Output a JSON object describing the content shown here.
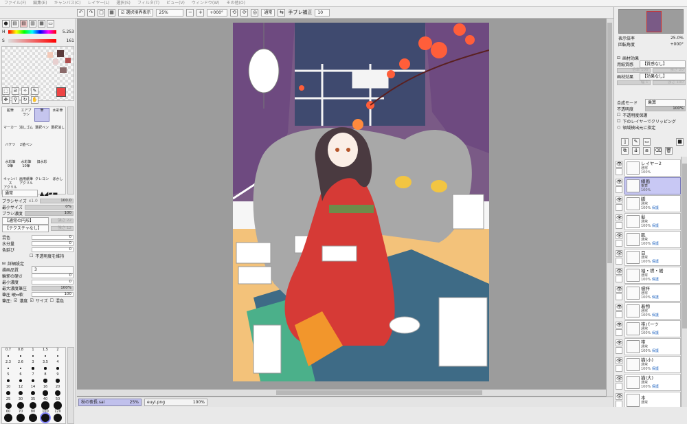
{
  "menu": [
    "ファイル(F)",
    "編集(E)",
    "キャンバス(C)",
    "レイヤー(L)",
    "選択(S)",
    "フィルタ(T)",
    "ビュー(V)",
    "ウィンドウ(W)",
    "その他(O)"
  ],
  "toolbar": {
    "selection_outline_label": "選択境界表示",
    "zoom_value": "25%",
    "rotate_value": "+000°",
    "mode_value": "通常",
    "stabilizer_label": "手ブレ補正",
    "stabilizer_value": "10"
  },
  "color_panel": {
    "h_label": "H",
    "h_value": "5.253",
    "s_label": "S",
    "s_value": "161",
    "v_label": "V",
    "v_value": "240",
    "primary_color": "#ee4444"
  },
  "tools": [
    {
      "label": "鉛筆"
    },
    {
      "label": "エアブラシ"
    },
    {
      "label": "筆"
    },
    {
      "label": "水彩筆"
    },
    {
      "label": "マーカー"
    },
    {
      "label": "消しゴム"
    },
    {
      "label": "選択ペン"
    },
    {
      "label": "選択消し"
    },
    {
      "label": "バケツ"
    },
    {
      "label": "2値ペン"
    },
    {
      "label": ""
    },
    {
      "label": ""
    },
    {
      "label": "水彩筆\n9筆"
    },
    {
      "label": "水彩筆\n10筆"
    },
    {
      "label": "旧水彩"
    },
    {
      "label": ""
    },
    {
      "label": "キャンバス\nアクリル"
    },
    {
      "label": "画用紙筆\nアクリル"
    },
    {
      "label": "クレヨン"
    },
    {
      "label": "ぼかし"
    }
  ],
  "brush": {
    "blend_mode": "通常",
    "size_label": "ブラシサイズ",
    "size_mult": "x1.0",
    "size_value": "100.0",
    "min_size_label": "最小サイズ",
    "min_size_value": "0%",
    "density_label": "ブラシ濃度",
    "density_value": "100",
    "shape_label": "【通常の円形】",
    "shape_value": "強さ 22",
    "texture_label": "【テクスチャなし】",
    "texture_value": "強さ 12",
    "mix_label": "混色",
    "mix_value": "0",
    "water_label": "水分量",
    "water_value": "0",
    "persist_label": "色延び",
    "persist_value": "0",
    "keep_opacity_label": "不透明度を維持",
    "advanced_label": "詳細設定",
    "quality_label": "描画品質",
    "quality_value": "3",
    "edge_label": "輪郭の硬さ",
    "edge_value": "0",
    "min_density_label": "最小濃度",
    "min_density_value": "0",
    "max_density_label": "最大濃度筆圧",
    "max_density_value": "100%",
    "pressure_label": "筆圧 硬⇔軟",
    "pressure_value": "100",
    "pressure_opts_label": "筆圧:",
    "pressure_density": "濃度",
    "pressure_size": "サイズ",
    "pressure_mix": "混色"
  },
  "brush_sizes": [
    "0.7",
    "0.8",
    "1",
    "1.5",
    "2",
    "2.3",
    "2.6",
    "3",
    "3.5",
    "4",
    "5",
    "6",
    "7",
    "8",
    "9",
    "10",
    "12",
    "14",
    "16",
    "20",
    "25",
    "30",
    "35",
    "40",
    "50",
    "60",
    "70",
    "80",
    "100",
    "120"
  ],
  "documents": [
    {
      "name": "秋の夜長.sai",
      "zoom": "25%",
      "active": true
    },
    {
      "name": "euyi.png",
      "zoom": "100%",
      "active": false
    }
  ],
  "navigator": {
    "zoom_label": "表示倍率",
    "zoom_value": "25.0%",
    "angle_label": "回転角度",
    "angle_value": "+000°"
  },
  "paper_effect": {
    "header": "画材効果",
    "texture_label": "用紙質感",
    "texture_value": "【質感なし】",
    "texture_scale": "倍率 100",
    "texture_strength": "強さ 20",
    "effect_label": "画材効果",
    "effect_value": "【効果なし】",
    "effect_width": "幅 1",
    "effect_strength": "強さ 100"
  },
  "layer_props": {
    "blend_label": "合成モード",
    "blend_value": "乗算",
    "opacity_label": "不透明度",
    "opacity_value": "100%",
    "protect_opacity": "不透明度保護",
    "clip": "下のレイヤーでクリッピング",
    "selection_source": "領域検出元に指定"
  },
  "layers": [
    {
      "name": "レイヤー2",
      "mode": "通常",
      "opacity": "100%",
      "protect": "",
      "selected": false
    },
    {
      "name": "線画",
      "mode": "乗算",
      "opacity": "100%",
      "protect": "",
      "selected": true
    },
    {
      "name": "脚",
      "mode": "通常",
      "opacity": "100%",
      "protect": "保護",
      "selected": false
    },
    {
      "name": "髪",
      "mode": "通常",
      "opacity": "100%",
      "protect": "保護",
      "selected": false
    },
    {
      "name": "肌",
      "mode": "通常",
      "opacity": "100%",
      "protect": "保護",
      "selected": false
    },
    {
      "name": "目",
      "mode": "通常",
      "opacity": "100%",
      "protect": "保護",
      "selected": false
    },
    {
      "name": "袖・襟・裾",
      "mode": "通常",
      "opacity": "100%",
      "protect": "保護",
      "selected": false
    },
    {
      "name": "襦袢",
      "mode": "通常",
      "opacity": "100%",
      "protect": "保護",
      "selected": false
    },
    {
      "name": "着物",
      "mode": "通常",
      "opacity": "100%",
      "protect": "保護",
      "selected": false
    },
    {
      "name": "帯パーツ",
      "mode": "通常",
      "opacity": "100%",
      "protect": "保護",
      "selected": false
    },
    {
      "name": "帯",
      "mode": "通常",
      "opacity": "100%",
      "protect": "保護",
      "selected": false
    },
    {
      "name": "猫(小)",
      "mode": "通常",
      "opacity": "100%",
      "protect": "保護",
      "selected": false
    },
    {
      "name": "猫(大)",
      "mode": "通常",
      "opacity": "100%",
      "protect": "保護",
      "selected": false
    },
    {
      "name": "本",
      "mode": "通常",
      "opacity": "",
      "protect": "",
      "selected": false
    }
  ]
}
